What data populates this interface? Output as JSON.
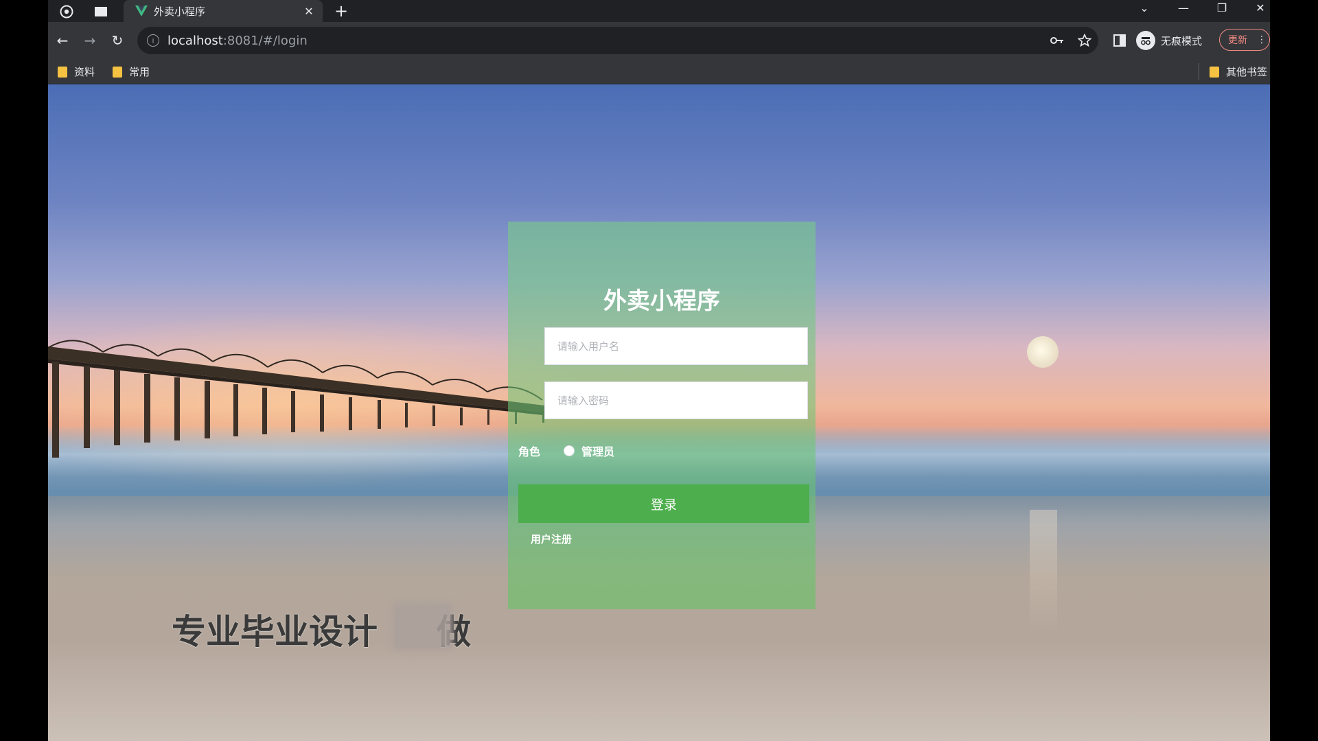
{
  "browser": {
    "tab": {
      "title": "外卖小程序",
      "close": "✕"
    },
    "new_tab": "+",
    "window_controls": {
      "dropdown": "⌄",
      "minimize": "—",
      "restore": "❐",
      "close": "✕"
    },
    "nav": {
      "back": "←",
      "forward": "→",
      "reload": "↻"
    },
    "address": {
      "host": "localhost",
      "rest": ":8081/#/login"
    },
    "incognito_label": "无痕模式",
    "update_label": "更新",
    "bookmarks": [
      {
        "label": "资料"
      },
      {
        "label": "常用"
      }
    ],
    "other_bookmarks": "其他书签"
  },
  "login": {
    "title": "外卖小程序",
    "username_placeholder": "请输入用户名",
    "password_placeholder": "请输入密码",
    "role_label": "角色",
    "role_option": "管理员",
    "submit_label": "登录",
    "register_label": "用户注册"
  },
  "watermark": "专业毕业设计",
  "watermark_tail": "做",
  "colors": {
    "login_button": "#4cae4c",
    "card_overlay": "#78c88c",
    "update_outline": "#f28b82",
    "bookmark_folder": "#f5c242"
  },
  "icons": [
    "chrome-logo-icon",
    "window-icon",
    "vue-logo-icon",
    "key-icon",
    "star-icon",
    "sidebar-icon",
    "incognito-icon",
    "folder-icon"
  ]
}
